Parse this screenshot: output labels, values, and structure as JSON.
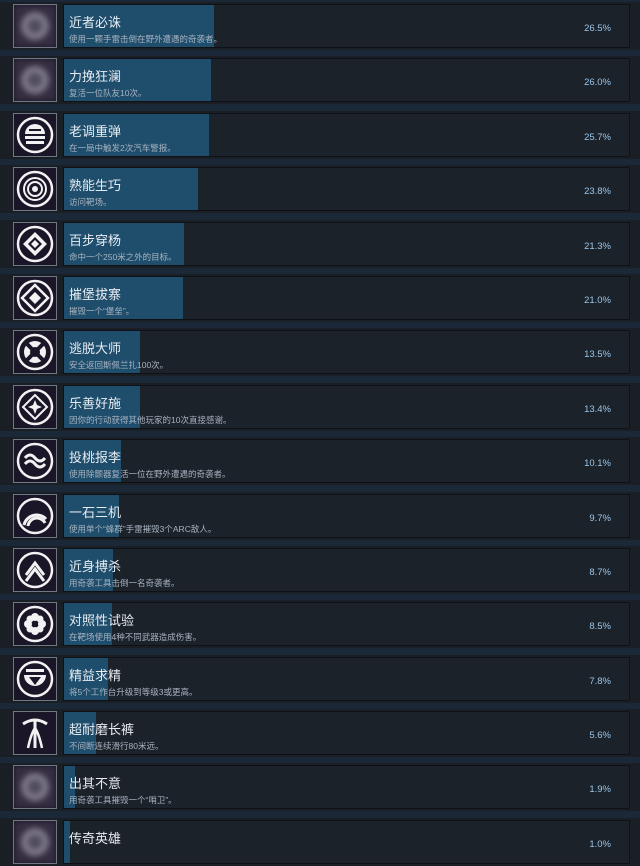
{
  "colors": {
    "page_bg": "#1b2838",
    "row_bg": "#1c222a",
    "progress_fill": "#1f4d6c",
    "title_text": "#e6ecf2",
    "desc_text": "#a7b3c0",
    "percent_text": "#99c6ea",
    "icon_bg": "#1a1527"
  },
  "achievements": [
    {
      "title": "近者必诛",
      "desc": "使用一颗手雷击倒在野外遭遇的奇袭者。",
      "percent": "26.5%",
      "progress": 26.5,
      "icon": "locked-blurred-icon"
    },
    {
      "title": "力挽狂澜",
      "desc": "复活一位队友10次。",
      "percent": "26.0%",
      "progress": 26.0,
      "icon": "locked-blurred-icon"
    },
    {
      "title": "老调重弹",
      "desc": "在一局中触发2次汽车警报。",
      "percent": "25.7%",
      "progress": 25.7,
      "icon": "striped-dome-icon"
    },
    {
      "title": "熟能生巧",
      "desc": "访问靶场。",
      "percent": "23.8%",
      "progress": 23.8,
      "icon": "concentric-rings-icon"
    },
    {
      "title": "百步穿杨",
      "desc": "命中一个250米之外的目标。",
      "percent": "21.3%",
      "progress": 21.3,
      "icon": "crosshair-diamond-icon"
    },
    {
      "title": "摧堡拔寨",
      "desc": "摧毁一个“堡垒”。",
      "percent": "21.0%",
      "progress": 21.0,
      "icon": "fortress-diamond-icon"
    },
    {
      "title": "逃脱大师",
      "desc": "安全返回斯佩兰扎100次。",
      "percent": "13.5%",
      "progress": 13.5,
      "icon": "lifebuoy-icon"
    },
    {
      "title": "乐善好施",
      "desc": "因你的行动获得其他玩家的10次直接感谢。",
      "percent": "13.4%",
      "progress": 13.4,
      "icon": "diamond-star-icon"
    },
    {
      "title": "投桃报李",
      "desc": "使用除颤器复活一位在野外遭遇的奇袭者。",
      "percent": "10.1%",
      "progress": 10.1,
      "icon": "wave-swirl-icon"
    },
    {
      "title": "一石三机",
      "desc": "使用单个“蜂群”手雷摧毁3个ARC敌人。",
      "percent": "9.7%",
      "progress": 9.7,
      "icon": "arcs-icon"
    },
    {
      "title": "近身搏杀",
      "desc": "用奇袭工具击倒一名奇袭者。",
      "percent": "8.7%",
      "progress": 8.7,
      "icon": "chevron-stack-icon"
    },
    {
      "title": "对照性试验",
      "desc": "在靶场使用4种不同武器造成伤害。",
      "percent": "8.5%",
      "progress": 8.5,
      "icon": "flower-icon"
    },
    {
      "title": "精益求精",
      "desc": "将5个工作台升级到等级3或更高。",
      "percent": "7.8%",
      "progress": 7.8,
      "icon": "bowl-triangle-icon"
    },
    {
      "title": "超耐磨长裤",
      "desc": "不间断连续滑行80米远。",
      "percent": "5.6%",
      "progress": 5.6,
      "icon": "fountain-icon"
    },
    {
      "title": "出其不意",
      "desc": "用奇袭工具摧毁一个“哨卫”。",
      "percent": "1.9%",
      "progress": 1.9,
      "icon": "locked-blurred-icon"
    },
    {
      "title": "传奇英雄",
      "desc": "",
      "percent": "1.0%",
      "progress": 1.0,
      "icon": "locked-blurred-icon"
    }
  ]
}
